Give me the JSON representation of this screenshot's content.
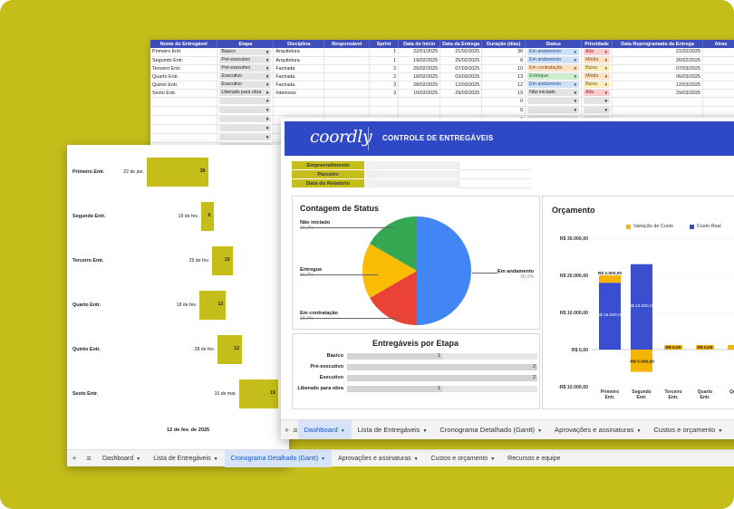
{
  "task_sheet": {
    "headers": [
      "Nome do Entregável",
      "Etapa",
      "Disciplina",
      "Responsável",
      "Sprint",
      "Data de Início",
      "Data da Entrega",
      "Duração (dias)",
      "Status",
      "Prioridade",
      "Data Reprogramada da Entrega",
      "Atras"
    ],
    "rows": [
      {
        "nome": "Primeiro Entr.",
        "etapa": "Básico",
        "disc": "Arquitetura",
        "sprint": "1",
        "inicio": "22/01/2025",
        "entrega": "21/02/2025",
        "dur": "30",
        "status": "Em andamento",
        "prio": "Alta",
        "reprog": "21/02/2025"
      },
      {
        "nome": "Segundo Entr.",
        "etapa": "Pré-executivo",
        "disc": "Arquitetura",
        "sprint": "1",
        "inicio": "19/02/2025",
        "entrega": "25/02/2025",
        "dur": "6",
        "status": "Em andamento",
        "prio": "Média",
        "reprog": "26/02/2025"
      },
      {
        "nome": "Terceiro Entr.",
        "etapa": "Pré-executivo",
        "disc": "Fachada",
        "sprint": "2",
        "inicio": "25/02/2025",
        "entrega": "07/03/2025",
        "dur": "10",
        "status": "Em contratação",
        "prio": "Baixa",
        "reprog": "07/03/2025"
      },
      {
        "nome": "Quarto Entr.",
        "etapa": "Executivo",
        "disc": "Fachada",
        "sprint": "2",
        "inicio": "18/02/2025",
        "entrega": "03/03/2025",
        "dur": "13",
        "status": "Entregue",
        "prio": "Média",
        "reprog": "06/03/2025"
      },
      {
        "nome": "Quinto Entr.",
        "etapa": "Executivo",
        "disc": "Fachada",
        "sprint": "3",
        "inicio": "28/02/2025",
        "entrega": "12/03/2025",
        "dur": "12",
        "status": "Em andamento",
        "prio": "Baixa",
        "reprog": "12/03/2025"
      },
      {
        "nome": "Sexto Entr.",
        "etapa": "Liberado para obra",
        "disc": "Interiores",
        "sprint": "3",
        "inicio": "10/03/2025",
        "entrega": "29/03/2025",
        "dur": "19",
        "status": "Não iniciado",
        "prio": "Alta",
        "reprog": "29/03/2025"
      }
    ],
    "empty_zero": "0"
  },
  "gantt": {
    "rows": [
      {
        "label": "Primeiro Entr.",
        "date": "22 de jan.",
        "value": "30"
      },
      {
        "label": "Segundo Entr.",
        "date": "19 de fev.",
        "value": "6"
      },
      {
        "label": "Terceiro Entr.",
        "date": "25 de fev.",
        "value": "10"
      },
      {
        "label": "Quarto Entr.",
        "date": "18 de fev.",
        "value": "13"
      },
      {
        "label": "Quinto Entr.",
        "date": "28 de fev.",
        "value": "12"
      },
      {
        "label": "Sexto Entr.",
        "date": "10 de mar.",
        "value": "19"
      }
    ],
    "footer": "12 de fev. de 2025"
  },
  "back_tabs": [
    "Dashboard",
    "Lista de Entregáveis",
    "Cronograma Detalhado (Gantt)",
    "Aprovações e assinaturas",
    "Custos e orçamento",
    "Recursos e equipe"
  ],
  "back_active_tab": 2,
  "dashboard": {
    "logo": "coordly",
    "title": "CONTROLE DE ENTREGÁVEIS",
    "info": [
      "Empreendimento",
      "Parceiro",
      "Data do Relatório"
    ],
    "status_title": "Contagem de Status",
    "status_slices": [
      {
        "label": "Em andamento",
        "pct": "50,0%",
        "value": 3,
        "color": "#4285f4"
      },
      {
        "label": "Em contratação",
        "pct": "16,7%",
        "value": 1,
        "color": "#ea4335"
      },
      {
        "label": "Entregue",
        "pct": "16,7%",
        "value": 1,
        "color": "#fbbc04"
      },
      {
        "label": "Não iniciado",
        "pct": "16,7%",
        "value": 1,
        "color": "#34a853"
      }
    ],
    "etapa_title": "Entregáveis por Etapa",
    "etapas": [
      {
        "label": "Básico",
        "value": 1
      },
      {
        "label": "Pré-executivo",
        "value": 2
      },
      {
        "label": "Executivo",
        "value": 2
      },
      {
        "label": "Liberado para obra",
        "value": 1
      }
    ],
    "orc_title": "Orçamento",
    "orc_legend": [
      {
        "label": "Variação de Custo",
        "color": "#f4b400"
      },
      {
        "label": "Custo Real",
        "color": "#3a4fcf"
      }
    ],
    "orc_ticks": [
      "R$ 30.000,00",
      "R$ 20.000,00",
      "R$ 10.000,00",
      "R$ 0,00",
      "-R$ 10.000,00"
    ],
    "orc_categories": [
      "Primeiro Entr.",
      "Segundo Entr.",
      "Terceiro Entr.",
      "Quarto Entr.",
      "Quinto"
    ],
    "orc_real": [
      18000,
      23000,
      0,
      0,
      0
    ],
    "orc_var": [
      2000,
      -6000,
      0,
      0,
      0
    ],
    "orc_labels_real": [
      "R$ 18.000,00",
      "R$ 23.000,00",
      "",
      "",
      ""
    ],
    "orc_labels_var": [
      "R$ 2.000,00",
      "-R$ 6.000,00",
      "R$ 0,00",
      "R$ 0,00",
      "R$"
    ],
    "tabs": [
      "Dashboard",
      "Lista de Entregáveis",
      "Cronograma Detalhado (Gantt)",
      "Aprovações e assinaturas",
      "Custos e orçamento",
      "Recu"
    ],
    "active_tab": 0
  },
  "chart_data": [
    {
      "type": "pie",
      "title": "Contagem de Status",
      "categories": [
        "Em andamento",
        "Em contratação",
        "Entregue",
        "Não iniciado"
      ],
      "values": [
        3,
        1,
        1,
        1
      ]
    },
    {
      "type": "bar",
      "title": "Entregáveis por Etapa",
      "categories": [
        "Básico",
        "Pré-executivo",
        "Executivo",
        "Liberado para obra"
      ],
      "values": [
        1,
        2,
        2,
        1
      ]
    },
    {
      "type": "bar",
      "title": "Orçamento",
      "categories": [
        "Primeiro Entr.",
        "Segundo Entr.",
        "Terceiro Entr.",
        "Quarto Entr.",
        "Quinto"
      ],
      "series": [
        {
          "name": "Variação de Custo",
          "values": [
            2000,
            -6000,
            0,
            0,
            0
          ]
        },
        {
          "name": "Custo Real",
          "values": [
            18000,
            23000,
            0,
            0,
            0
          ]
        }
      ],
      "ylim": [
        -10000,
        30000
      ],
      "legend": "top"
    },
    {
      "type": "bar",
      "title": "",
      "categories": [
        "Primeiro Entr.",
        "Segundo Entr.",
        "Terceiro Entr.",
        "Quarto Entr.",
        "Quinto Entr.",
        "Sexto Entr."
      ],
      "series": [
        {
          "values": [
            30,
            6,
            10,
            13,
            12,
            19
          ]
        }
      ],
      "start": [
        "2025-01-22",
        "2025-02-19",
        "2025-02-25",
        "2025-02-18",
        "2025-02-28",
        "2025-03-10"
      ]
    }
  ]
}
